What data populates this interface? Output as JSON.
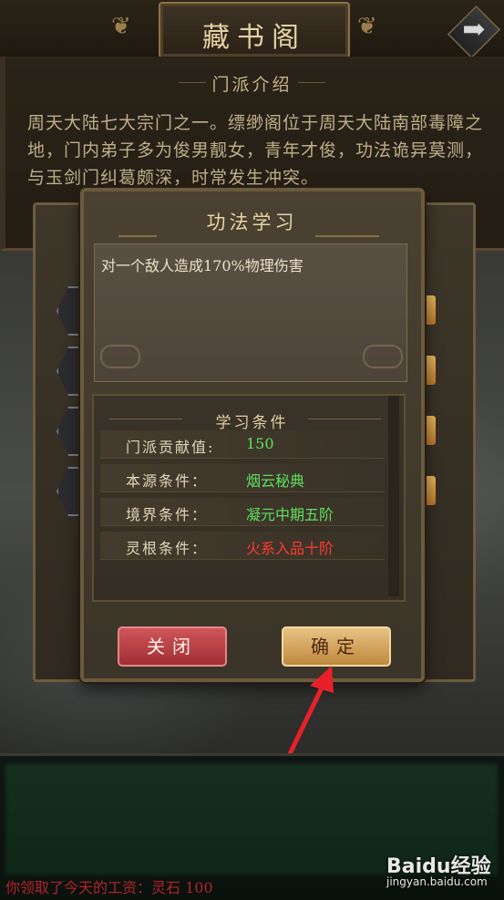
{
  "header": {
    "title": "藏书阁",
    "next_icon": "arrow-right-icon"
  },
  "intro": {
    "heading": "门派介绍",
    "text": "周天大陆七大宗门之一。缥缈阁位于周天大陆南部毒障之地，门内弟子多为俊男靓女，青年才俊，功法诡异莫测，与玉剑门纠葛颇深，时常发生冲突。"
  },
  "dialog": {
    "title": "功法学习",
    "description": "对一个敌人造成170%物理伤害",
    "conditions_heading": "学习条件",
    "conditions": [
      {
        "label": "门派贡献值:",
        "value": "150",
        "color": "#5fe05f"
      },
      {
        "label": "本源条件：",
        "value": "烟云秘典",
        "color": "#5fe05f"
      },
      {
        "label": "境界条件：",
        "value": "凝元中期五阶",
        "color": "#5fe05f"
      },
      {
        "label": "灵根条件：",
        "value": "火系入品十阶",
        "color": "#ff3b30"
      }
    ],
    "close_label": "关闭",
    "confirm_label": "确定"
  },
  "footer": {
    "bottom_text": "你领取了今天的工资：灵石 100"
  },
  "watermark": {
    "brand": "Baidu经验",
    "url": "jingyan.baidu.com"
  }
}
